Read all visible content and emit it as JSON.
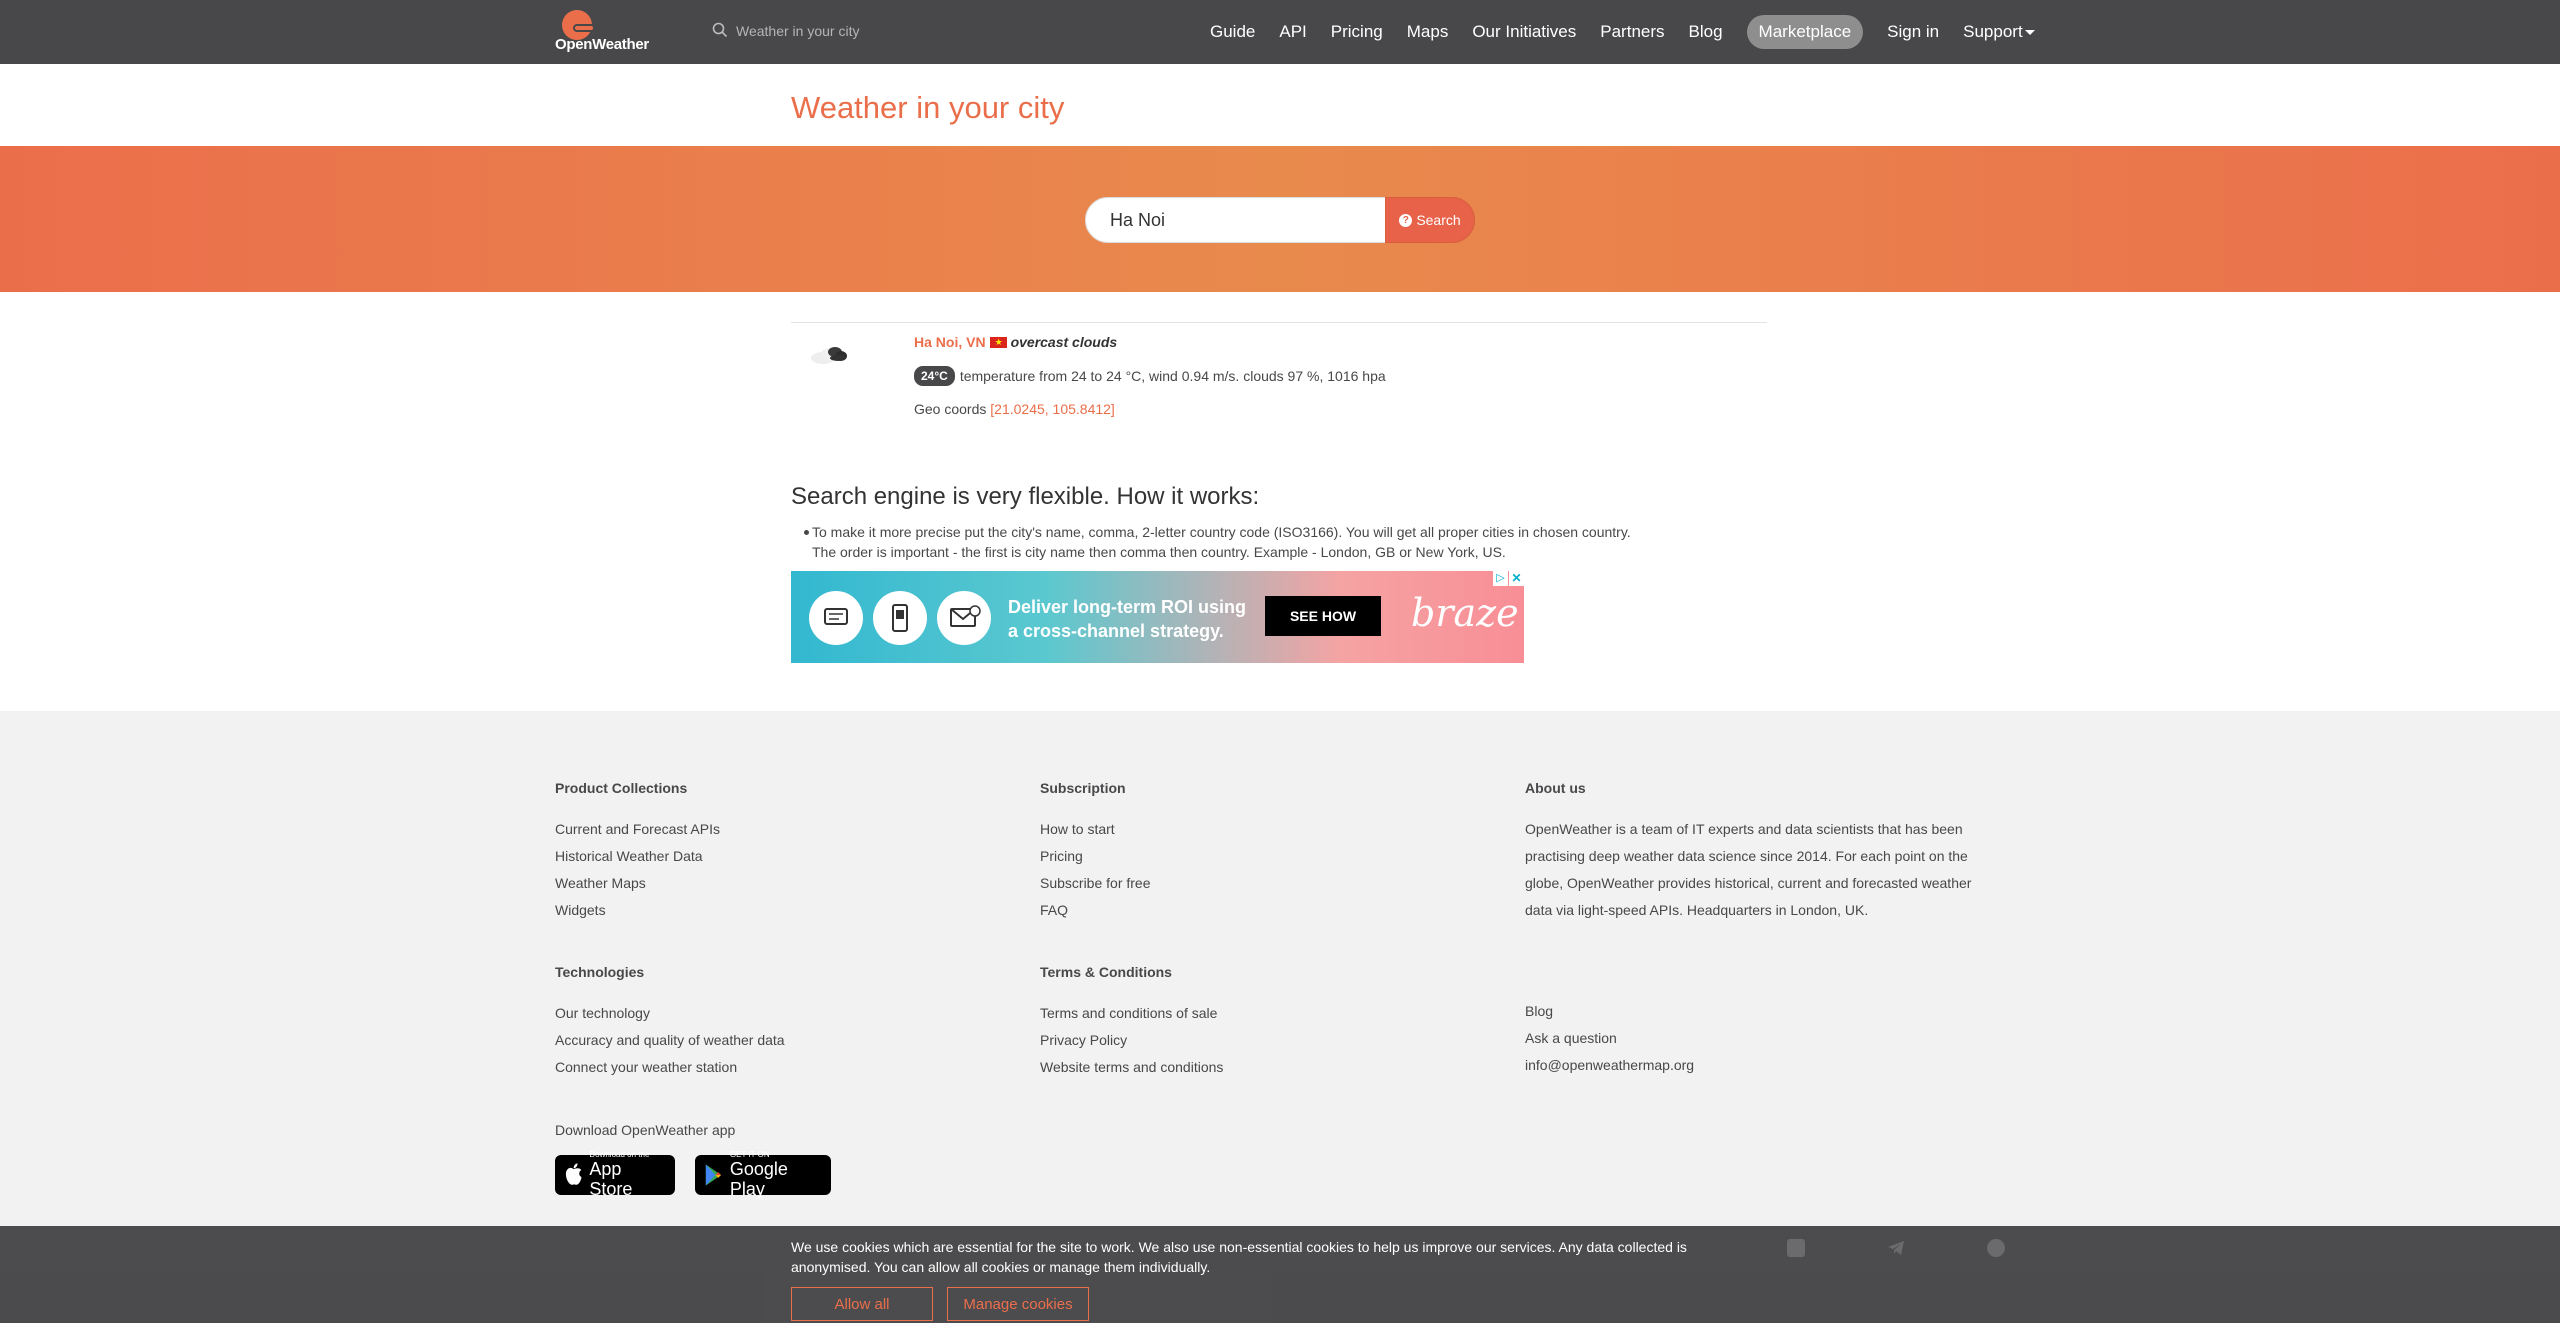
{
  "nav": {
    "logo_text": "OpenWeather",
    "search_placeholder": "Weather in your city",
    "links": [
      "Guide",
      "API",
      "Pricing",
      "Maps",
      "Our Initiatives",
      "Partners",
      "Blog",
      "Marketplace",
      "Sign in"
    ],
    "support_label": "Support"
  },
  "page": {
    "title": "Weather in your city"
  },
  "search": {
    "value": "Ha Noi",
    "button_label": "Search"
  },
  "result": {
    "city": "Ha Noi, VN",
    "description": "overcast clouds",
    "temp_badge": "24°C",
    "details": "temperature from 24 to 24 °C, wind 0.94 m/s. clouds 97 %, 1016 hpa",
    "geo_label": "Geo coords",
    "geo_coords": "[21.0245, 105.8412]"
  },
  "how": {
    "title": "Search engine is very flexible. How it works:",
    "line1": "To make it more precise put the city's name, comma, 2-letter country code (ISO3166). You will get all proper cities in chosen country.",
    "line2": "The order is important - the first is city name then comma then country. Example - London, GB or New York, US."
  },
  "ad": {
    "line1": "Deliver long-term ROI using",
    "line2": "a cross-channel strategy.",
    "button": "SEE HOW",
    "brand": "braze"
  },
  "footer": {
    "product": {
      "title": "Product Collections",
      "items": [
        "Current and Forecast APIs",
        "Historical Weather Data",
        "Weather Maps",
        "Widgets"
      ]
    },
    "subscription": {
      "title": "Subscription",
      "items": [
        "How to start",
        "Pricing",
        "Subscribe for free",
        "FAQ"
      ]
    },
    "about": {
      "title": "About us",
      "text": "OpenWeather is a team of IT experts and data scientists that has been practising deep weather data science since 2014. For each point on the globe, OpenWeather provides historical, current and forecasted weather data via light-speed APIs. Headquarters in London, UK."
    },
    "technologies": {
      "title": "Technologies",
      "items": [
        "Our technology",
        "Accuracy and quality of weather data",
        "Connect your weather station"
      ]
    },
    "terms": {
      "title": "Terms & Conditions",
      "items": [
        "Terms and conditions of sale",
        "Privacy Policy",
        "Website terms and conditions"
      ]
    },
    "contact": {
      "items": [
        "Blog",
        "Ask a question",
        "info@openweathermap.org"
      ]
    },
    "download_label": "Download OpenWeather app",
    "appstore": {
      "small": "Download on the",
      "big": "App Store"
    },
    "googleplay": {
      "small": "GET IT ON",
      "big": "Google Play"
    }
  },
  "cookie": {
    "text": "We use cookies which are essential for the site to work. We also use non-essential cookies to help us improve our services. Any data collected is anonymised. You can allow all cookies or manage them individually.",
    "allow": "Allow all",
    "manage": "Manage cookies"
  }
}
